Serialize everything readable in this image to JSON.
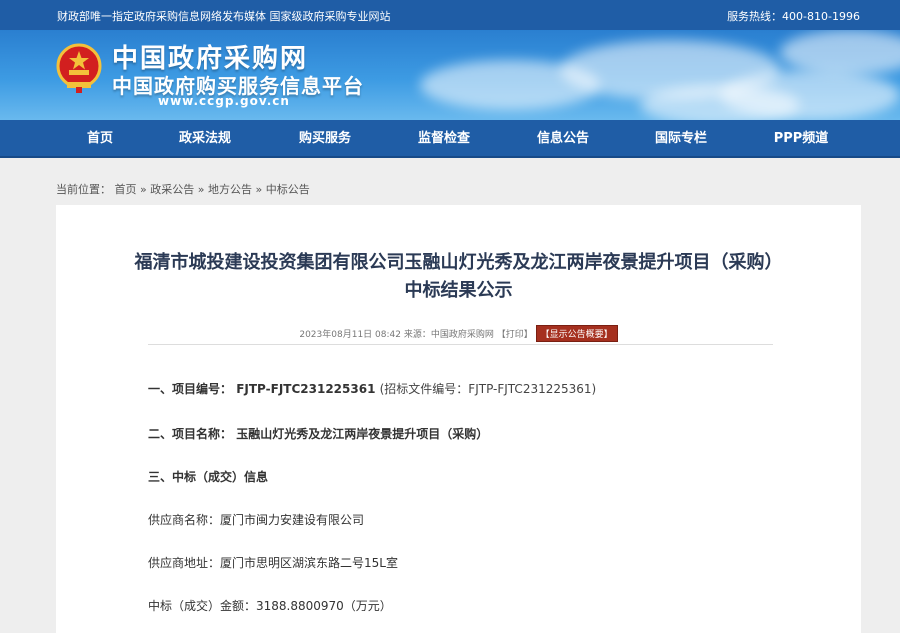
{
  "topbar": {
    "notice": "财政部唯一指定政府采购信息网络发布媒体 国家级政府采购专业网站",
    "hotline": "服务热线：400-810-1996"
  },
  "banner": {
    "title": "中国政府采购网",
    "subtitle": "中国政府购买服务信息平台",
    "url": "www.ccgp.gov.cn"
  },
  "nav": [
    {
      "label": "首页"
    },
    {
      "label": "政采法规"
    },
    {
      "label": "购买服务"
    },
    {
      "label": "监督检查"
    },
    {
      "label": "信息公告"
    },
    {
      "label": "国际专栏"
    },
    {
      "label": "PPP频道"
    }
  ],
  "breadcrumb": {
    "prefix": "当前位置：",
    "items": [
      "首页",
      "政采公告",
      "地方公告",
      "中标公告"
    ],
    "sep": "»"
  },
  "article": {
    "title_line1": "福清市城投建设投资集团有限公司玉融山灯光秀及龙江两岸夜景提升项目（采购）",
    "title_line2": "中标结果公示",
    "meta_date": "2023年08月11日 08:42",
    "meta_source": "来源：中国政府采购网",
    "print_label": "【打印】",
    "overview_label": "【显示公告概要】",
    "sections": {
      "s1_label": "一、项目编号：",
      "s1_value": "FJTP-FJTC231225361",
      "s1_note": "(招标文件编号：FJTP-FJTC231225361)",
      "s2_label": "二、项目名称：",
      "s2_value": "玉融山灯光秀及龙江两岸夜景提升项目（采购）",
      "s3_label": "三、中标（成交）信息",
      "supplier_name": "供应商名称：厦门市闽力安建设有限公司",
      "supplier_address": "供应商地址：厦门市思明区湖滨东路二号15L室",
      "amount": "中标（成交）金额：3188.8800970（万元）"
    }
  },
  "colors": {
    "primary_blue": "#1f5da6",
    "title_text": "#2b3a55",
    "overview_badge": "#a5301f"
  }
}
